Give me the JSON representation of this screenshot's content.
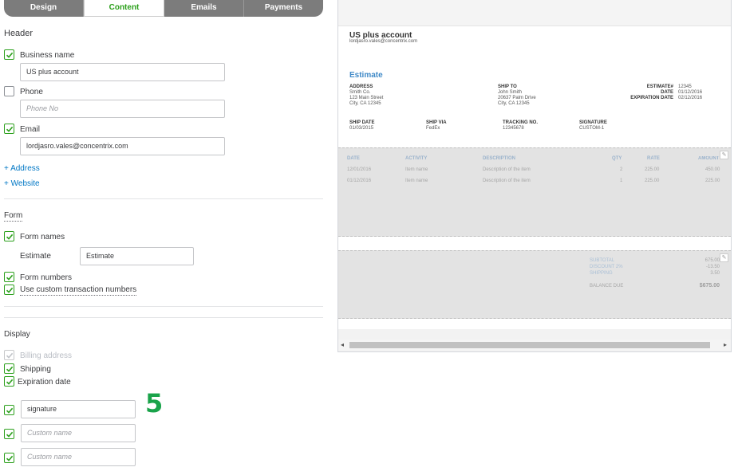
{
  "tabs": [
    {
      "label": "Design"
    },
    {
      "label": "Content"
    },
    {
      "label": "Emails"
    },
    {
      "label": "Payments"
    }
  ],
  "header": {
    "title": "Header",
    "business_name_label": "Business name",
    "business_name_value": "US plus account",
    "phone_label": "Phone",
    "phone_placeholder": "Phone No",
    "email_label": "Email",
    "email_value": "lordjasro.vales@concentrix.com",
    "add_address": "+ Address",
    "add_website": "+ Website"
  },
  "form": {
    "title": "Form",
    "form_names_label": "Form names",
    "estimate_label": "Estimate",
    "estimate_value": "Estimate",
    "form_numbers_label": "Form numbers",
    "custom_numbers_label": "Use custom transaction numbers"
  },
  "display": {
    "title": "Display",
    "billing_label": "Billing address",
    "shipping_label": "Shipping",
    "expiration_label": "Expiration date",
    "custom1_value": "signature",
    "custom2_placeholder": "Custom name",
    "custom3_placeholder": "Custom name"
  },
  "step_marker": "5",
  "preview": {
    "company": "US plus account",
    "email": "lordjasro.vales@concentrix.com",
    "doc_title": "Estimate",
    "address_head": "ADDRESS",
    "address_lines": [
      "Smith Co.",
      "123 Main Street",
      "City, CA 12345"
    ],
    "shipto_head": "SHIP TO",
    "shipto_lines": [
      "John Smith",
      "20637 Palm Drive",
      "City, CA 12345"
    ],
    "meta_labels": [
      "ESTIMATE#",
      "DATE",
      "EXPIRATION DATE"
    ],
    "meta_values": [
      "12345",
      "01/12/2016",
      "02/12/2016"
    ],
    "ship_date_head": "SHIP DATE",
    "ship_date": "01/03/2015",
    "ship_via_head": "SHIP VIA",
    "ship_via": "FedEx",
    "tracking_head": "TRACKING NO.",
    "tracking": "12345678",
    "signature_head": "SIGNATURE",
    "signature": "CUSTOM-1",
    "table_headers": [
      "DATE",
      "ACTIVITY",
      "DESCRIPTION",
      "QTY",
      "RATE",
      "AMOUNT"
    ],
    "rows": [
      {
        "date": "12/01/2016",
        "activity": "Item name",
        "desc": "Description of the item",
        "qty": "2",
        "rate": "225.00",
        "amount": "450.00"
      },
      {
        "date": "01/12/2016",
        "activity": "Item name",
        "desc": "Description of the item",
        "qty": "1",
        "rate": "225.00",
        "amount": "225.00"
      }
    ],
    "subtotal_label": "SUBTOTAL",
    "subtotal": "675.00",
    "discount_label": "DISCOUNT 2%",
    "discount": "-13.50",
    "shipping_label": "SHIPPING",
    "shipping": "3.50",
    "balance_label": "BALANCE DUE",
    "balance": "$675.00"
  },
  "colors": {
    "accent": "#2ca01c",
    "link": "#0077c5",
    "tab_bg": "#7c7c7c",
    "step": "#1aa34a",
    "doc_title": "#3f89c7"
  }
}
